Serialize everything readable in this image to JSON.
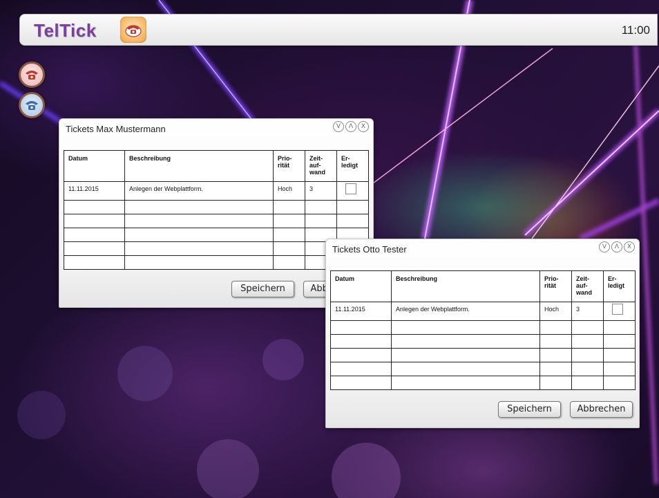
{
  "topbar": {
    "brand": "TelTick",
    "clock": "11:00"
  },
  "icons": {
    "brand_button": "telephone-icon",
    "side_red": "red-telephone-icon",
    "side_blue": "blue-telephone-icon"
  },
  "colors": {
    "brand": "#7a3fa0",
    "brand_button": "#f5b664"
  },
  "window1": {
    "title": "Tickets Max Mustermann",
    "controls": [
      "V",
      "Λ",
      "X"
    ],
    "headers": {
      "datum": "Datum",
      "beschreibung": "Beschreibung",
      "prioritaet": "Prio-\nrität",
      "zeitaufwand": "Zeit-\nauf-\nwand",
      "erledigt": "Er-\nledigt"
    },
    "rows": [
      {
        "datum": "11.11.2015",
        "beschreibung": "Anlegen  der Webplattform.",
        "prioritaet": "Hoch",
        "zeitaufwand": "3"
      }
    ],
    "save_label": "Speichern",
    "cancel_label": "Abbrechen"
  },
  "window2": {
    "title": "Tickets Otto Tester",
    "controls": [
      "V",
      "Λ",
      "X"
    ],
    "headers": {
      "datum": "Datum",
      "beschreibung": "Beschreibung",
      "prioritaet": "Prio-\nrität",
      "zeitaufwand": "Zeit-\nauf-\nwand",
      "erledigt": "Er-\nledigt"
    },
    "rows": [
      {
        "datum": "11.11.2015",
        "beschreibung": "Anlegen  der Webplattform.",
        "prioritaet": "Hoch",
        "zeitaufwand": "3"
      }
    ],
    "save_label": "Speichern",
    "cancel_label": "Abbrechen"
  }
}
